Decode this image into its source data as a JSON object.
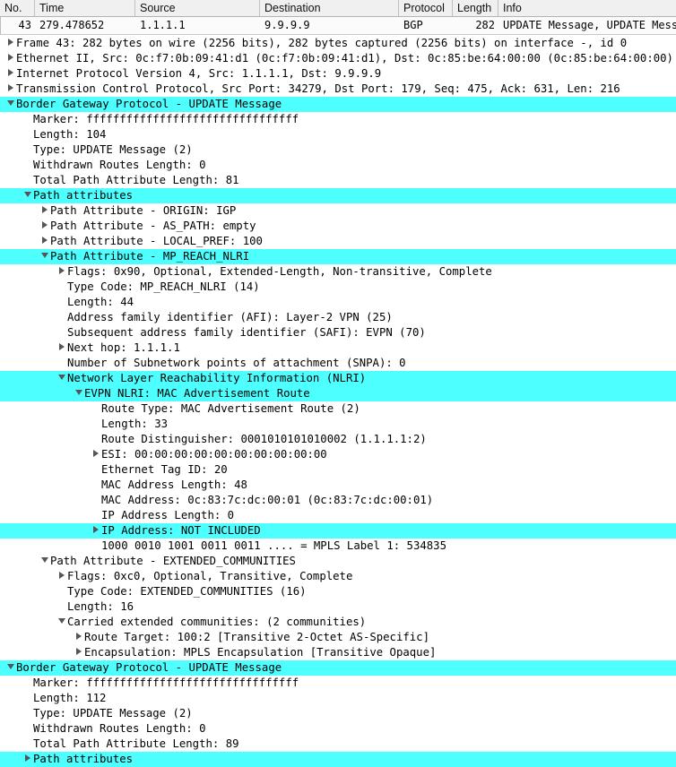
{
  "packet_list": {
    "columns": [
      {
        "key": "no",
        "label": "No."
      },
      {
        "key": "time",
        "label": "Time"
      },
      {
        "key": "src",
        "label": "Source"
      },
      {
        "key": "dst",
        "label": "Destination"
      },
      {
        "key": "proto",
        "label": "Protocol"
      },
      {
        "key": "len",
        "label": "Length"
      },
      {
        "key": "info",
        "label": "Info"
      }
    ],
    "rows": [
      {
        "no": "43",
        "time": "279.478652",
        "src": "1.1.1.1",
        "dst": "9.9.9.9",
        "proto": "BGP",
        "len": "282",
        "info": "UPDATE Message, UPDATE Message"
      }
    ]
  },
  "colors": {
    "highlight": "#4dffff",
    "header_bg": "#f0f0f0",
    "row_bg": "#fbfbfb",
    "text": "#000000"
  },
  "detail_tree": {
    "rows": [
      {
        "indent": 0,
        "twisty": "closed",
        "highlight": false,
        "text": "Frame 43: 282 bytes on wire (2256 bits), 282 bytes captured (2256 bits) on interface -, id 0"
      },
      {
        "indent": 0,
        "twisty": "closed",
        "highlight": false,
        "text": "Ethernet II, Src: 0c:f7:0b:09:41:d1 (0c:f7:0b:09:41:d1), Dst: 0c:85:be:64:00:00 (0c:85:be:64:00:00)"
      },
      {
        "indent": 0,
        "twisty": "closed",
        "highlight": false,
        "text": "Internet Protocol Version 4, Src: 1.1.1.1, Dst: 9.9.9.9"
      },
      {
        "indent": 0,
        "twisty": "closed",
        "highlight": false,
        "text": "Transmission Control Protocol, Src Port: 34279, Dst Port: 179, Seq: 475, Ack: 631, Len: 216"
      },
      {
        "indent": 0,
        "twisty": "open",
        "highlight": true,
        "full": true,
        "text": "Border Gateway Protocol - UPDATE Message"
      },
      {
        "indent": 1,
        "twisty": "none",
        "highlight": false,
        "text": "Marker: ffffffffffffffffffffffffffffffff"
      },
      {
        "indent": 1,
        "twisty": "none",
        "highlight": false,
        "text": "Length: 104"
      },
      {
        "indent": 1,
        "twisty": "none",
        "highlight": false,
        "text": "Type: UPDATE Message (2)"
      },
      {
        "indent": 1,
        "twisty": "none",
        "highlight": false,
        "text": "Withdrawn Routes Length: 0"
      },
      {
        "indent": 1,
        "twisty": "none",
        "highlight": false,
        "text": "Total Path Attribute Length: 81"
      },
      {
        "indent": 1,
        "twisty": "open",
        "highlight": true,
        "full": true,
        "text": "Path attributes"
      },
      {
        "indent": 2,
        "twisty": "closed",
        "highlight": false,
        "text": "Path Attribute - ORIGIN: IGP"
      },
      {
        "indent": 2,
        "twisty": "closed",
        "highlight": false,
        "text": "Path Attribute - AS_PATH: empty"
      },
      {
        "indent": 2,
        "twisty": "closed",
        "highlight": false,
        "text": "Path Attribute - LOCAL_PREF: 100"
      },
      {
        "indent": 2,
        "twisty": "open",
        "highlight": true,
        "full": true,
        "text": "Path Attribute - MP_REACH_NLRI"
      },
      {
        "indent": 3,
        "twisty": "closed",
        "highlight": false,
        "text": "Flags: 0x90, Optional, Extended-Length, Non-transitive, Complete"
      },
      {
        "indent": 3,
        "twisty": "none",
        "highlight": false,
        "text": "Type Code: MP_REACH_NLRI (14)"
      },
      {
        "indent": 3,
        "twisty": "none",
        "highlight": false,
        "text": "Length: 44"
      },
      {
        "indent": 3,
        "twisty": "none",
        "highlight": false,
        "text": "Address family identifier (AFI): Layer-2 VPN (25)"
      },
      {
        "indent": 3,
        "twisty": "none",
        "highlight": false,
        "text": "Subsequent address family identifier (SAFI): EVPN (70)"
      },
      {
        "indent": 3,
        "twisty": "closed",
        "highlight": false,
        "text": "Next hop: 1.1.1.1"
      },
      {
        "indent": 3,
        "twisty": "none",
        "highlight": false,
        "text": "Number of Subnetwork points of attachment (SNPA): 0"
      },
      {
        "indent": 3,
        "twisty": "open",
        "highlight": true,
        "full": true,
        "text": "Network Layer Reachability Information (NLRI)"
      },
      {
        "indent": 4,
        "twisty": "open",
        "highlight": true,
        "full": true,
        "text": "EVPN NLRI: MAC Advertisement Route"
      },
      {
        "indent": 5,
        "twisty": "none",
        "highlight": false,
        "text": "Route Type: MAC Advertisement Route (2)"
      },
      {
        "indent": 5,
        "twisty": "none",
        "highlight": false,
        "text": "Length: 33"
      },
      {
        "indent": 5,
        "twisty": "none",
        "highlight": false,
        "text": "Route Distinguisher: 0001010101010002 (1.1.1.1:2)"
      },
      {
        "indent": 5,
        "twisty": "closed",
        "highlight": false,
        "text": "ESI: 00:00:00:00:00:00:00:00:00:00"
      },
      {
        "indent": 5,
        "twisty": "none",
        "highlight": false,
        "text": "Ethernet Tag ID: 20"
      },
      {
        "indent": 5,
        "twisty": "none",
        "highlight": false,
        "text": "MAC Address Length: 48"
      },
      {
        "indent": 5,
        "twisty": "none",
        "highlight": false,
        "text": "MAC Address: 0c:83:7c:dc:00:01 (0c:83:7c:dc:00:01)"
      },
      {
        "indent": 5,
        "twisty": "none",
        "highlight": false,
        "text": "IP Address Length: 0"
      },
      {
        "indent": 5,
        "twisty": "closed",
        "highlight": true,
        "text": "IP Address: NOT INCLUDED"
      },
      {
        "indent": 5,
        "twisty": "none",
        "highlight": false,
        "text": "1000 0010 1001 0011 0011 .... = MPLS Label 1: 534835"
      },
      {
        "indent": 2,
        "twisty": "open",
        "highlight": false,
        "text": "Path Attribute - EXTENDED_COMMUNITIES"
      },
      {
        "indent": 3,
        "twisty": "closed",
        "highlight": false,
        "text": "Flags: 0xc0, Optional, Transitive, Complete"
      },
      {
        "indent": 3,
        "twisty": "none",
        "highlight": false,
        "text": "Type Code: EXTENDED_COMMUNITIES (16)"
      },
      {
        "indent": 3,
        "twisty": "none",
        "highlight": false,
        "text": "Length: 16"
      },
      {
        "indent": 3,
        "twisty": "open",
        "highlight": false,
        "text": "Carried extended communities: (2 communities)"
      },
      {
        "indent": 4,
        "twisty": "closed",
        "highlight": false,
        "text": "Route Target: 100:2 [Transitive 2-Octet AS-Specific]"
      },
      {
        "indent": 4,
        "twisty": "closed",
        "highlight": false,
        "text": "Encapsulation: MPLS Encapsulation [Transitive Opaque]"
      },
      {
        "indent": 0,
        "twisty": "open",
        "highlight": true,
        "full": true,
        "text": "Border Gateway Protocol - UPDATE Message"
      },
      {
        "indent": 1,
        "twisty": "none",
        "highlight": false,
        "text": "Marker: ffffffffffffffffffffffffffffffff"
      },
      {
        "indent": 1,
        "twisty": "none",
        "highlight": false,
        "text": "Length: 112"
      },
      {
        "indent": 1,
        "twisty": "none",
        "highlight": false,
        "text": "Type: UPDATE Message (2)"
      },
      {
        "indent": 1,
        "twisty": "none",
        "highlight": false,
        "text": "Withdrawn Routes Length: 0"
      },
      {
        "indent": 1,
        "twisty": "none",
        "highlight": false,
        "text": "Total Path Attribute Length: 89"
      },
      {
        "indent": 1,
        "twisty": "closed",
        "highlight": true,
        "full": true,
        "text": "Path attributes"
      }
    ]
  }
}
